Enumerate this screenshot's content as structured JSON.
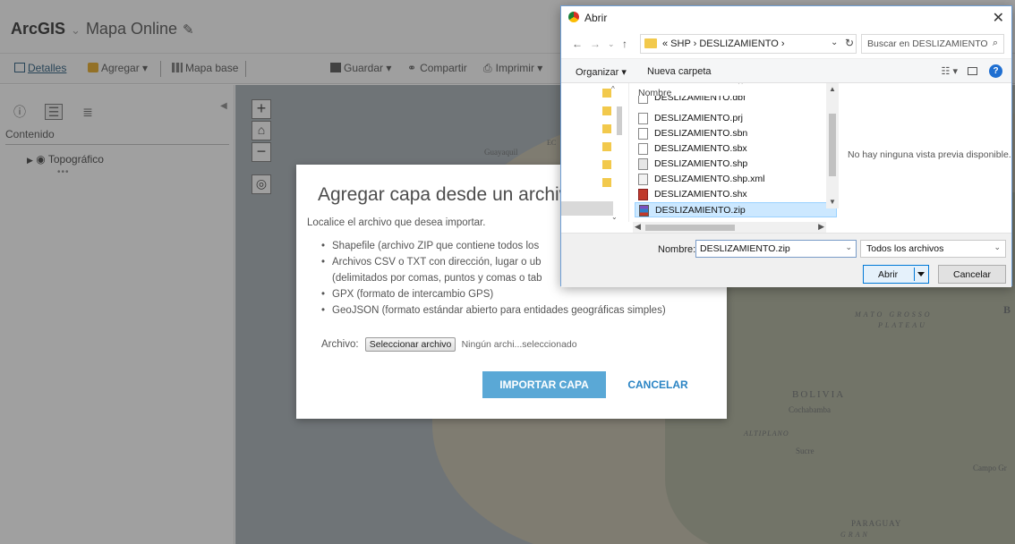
{
  "app": {
    "brand": "ArcGIS",
    "brand_chevron": "⌄",
    "map_title": "Mapa Online",
    "toolbar": {
      "details": "Detalles",
      "add": "Agregar",
      "basemap": "Mapa base",
      "save": "Guardar",
      "share": "Compartir",
      "print": "Imprimir"
    },
    "sidebar": {
      "heading": "Contenido",
      "layer": "Topográfico",
      "layer_dots": "•••"
    },
    "map_labels": {
      "guayaquil": "Guayaquil",
      "ec": "EC",
      "bolivia": "BOLIVIA",
      "cochabamba": "Cochabamba",
      "altiplano": "ALTIPLANO",
      "sucre": "Sucre",
      "mato_grosso": "MATO GROSSO",
      "plateau": "PLATEAU",
      "b": "B",
      "paraguay": "PARAGUAY",
      "gran": "GRAN",
      "campo_gr": "Campo Gr"
    }
  },
  "import_dialog": {
    "title": "Agregar capa desde un archivo",
    "intro": "Localice el archivo que desea importar.",
    "items": [
      "Shapefile (archivo ZIP que contiene todos los",
      "Archivos CSV o TXT con dirección, lugar o ub",
      "(delimitados por comas, puntos y comas o tab",
      "GPX (formato de intercambio GPS)",
      "GeoJSON (formato estándar abierto para entidades geográficas simples)"
    ],
    "file_label": "Archivo:",
    "choose_button": "Seleccionar archivo",
    "no_file": "Ningún archi...seleccionado",
    "import_button": "IMPORTAR CAPA",
    "cancel_button": "CANCELAR"
  },
  "file_dialog": {
    "title": "Abrir",
    "close": "✕",
    "path": "« SHP › DESLIZAMIENTO ›",
    "search_placeholder": "Buscar en DESLIZAMIENTO",
    "organize": "Organizar ▾",
    "new_folder": "Nueva carpeta",
    "column_header": "Nombre",
    "files": [
      {
        "name": "DESLIZAMIENTO.dbf",
        "type": "file"
      },
      {
        "name": "DESLIZAMIENTO.prj",
        "type": "file"
      },
      {
        "name": "DESLIZAMIENTO.sbn",
        "type": "file"
      },
      {
        "name": "DESLIZAMIENTO.sbx",
        "type": "file"
      },
      {
        "name": "DESLIZAMIENTO.shp",
        "type": "shp"
      },
      {
        "name": "DESLIZAMIENTO.shp.xml",
        "type": "xml"
      },
      {
        "name": "DESLIZAMIENTO.shx",
        "type": "shx"
      },
      {
        "name": "DESLIZAMIENTO.zip",
        "type": "zip",
        "selected": true
      }
    ],
    "preview_message": "No hay ninguna vista previa disponible.",
    "name_label": "Nombre:",
    "name_value": "DESLIZAMIENTO.zip",
    "file_type": "Todos los archivos",
    "open_button": "Abrir",
    "cancel_button": "Cancelar"
  },
  "colors": {
    "import_button": "#5aa8d6",
    "cancel_link": "#2a84c4",
    "selection": "#cce8ff",
    "folder": "#f2c94c"
  }
}
